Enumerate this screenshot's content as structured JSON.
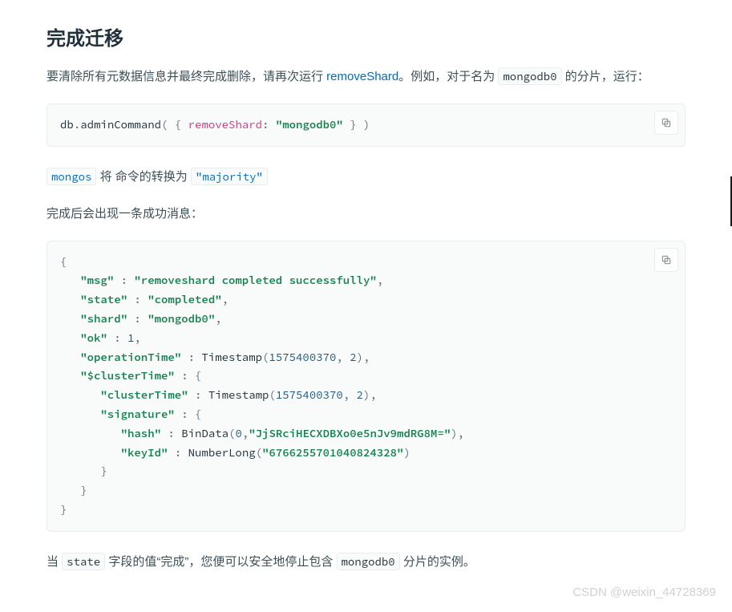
{
  "heading": "完成迁移",
  "para1": {
    "pre": "要清除所有元数据信息并最终完成删除，请再次运行 ",
    "link": "removeShard",
    "post_a": "。例如，对于名为 ",
    "code1": "mongodb0",
    "post_b": " 的分片，运行："
  },
  "code1": {
    "db": "db",
    "dot": ".",
    "admin": "adminCommand",
    "open": "( { ",
    "key": "removeShard",
    "colon": ": ",
    "val": "\"mongodb0\"",
    "close": " } )"
  },
  "para2": {
    "mongos": "mongos",
    "mid": " 将 命令的转换为 ",
    "majority": "\"majority\""
  },
  "para3": "完成后会出现一条成功消息：",
  "code2": {
    "l1": "{",
    "l2_k": "\"msg\"",
    "l2_v": "\"removeshard completed successfully\"",
    "l3_k": "\"state\"",
    "l3_v": "\"completed\"",
    "l4_k": "\"shard\"",
    "l4_v": "\"mongodb0\"",
    "l5_k": "\"ok\"",
    "l5_v": "1",
    "l6_k": "\"operationTime\"",
    "l6_f": "Timestamp",
    "l6_a": "1575400370",
    "l6_b": "2",
    "l7_k": "\"$clusterTime\"",
    "l8_k": "\"clusterTime\"",
    "l8_f": "Timestamp",
    "l8_a": "1575400370",
    "l8_b": "2",
    "l9_k": "\"signature\"",
    "l10_k": "\"hash\"",
    "l10_f": "BinData",
    "l10_a": "0",
    "l10_b": "\"JjSRciHECXDBXo0e5nJv9mdRG8M=\"",
    "l11_k": "\"keyId\"",
    "l11_f": "NumberLong",
    "l11_a": "\"6766255701040824328\"",
    "colon_sp": " : ",
    "comma": ",",
    "openp": "(",
    "closep": ")",
    "openb": "{",
    "closeb": "}"
  },
  "para4": {
    "pre": "当 ",
    "state": "state",
    "mid": " 字段的值“完成”，您便可以安全地停止包含 ",
    "mongo": "mongodb0",
    "post": " 分片的实例。"
  },
  "watermark": "CSDN @weixin_44728369",
  "copy_label": "复制"
}
